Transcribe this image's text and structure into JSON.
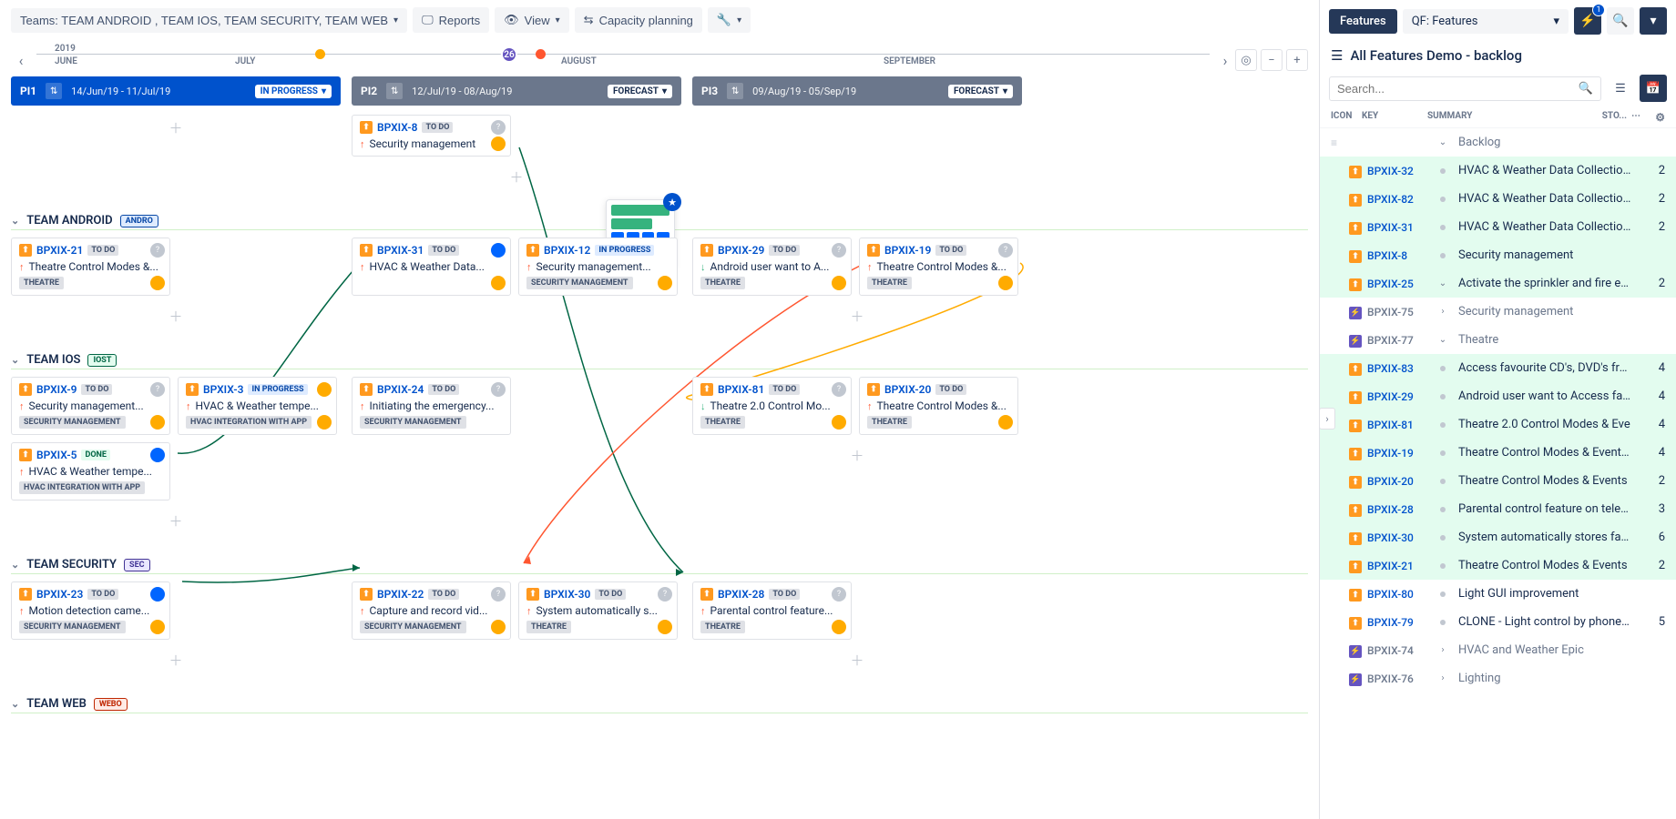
{
  "toolbar": {
    "teams_label": "Teams: TEAM ANDROID , TEAM IOS, TEAM SECURITY, TEAM WEB",
    "reports": "Reports",
    "view": "View",
    "capacity": "Capacity planning"
  },
  "timeline": {
    "year": "2019",
    "months": {
      "june": "JUNE",
      "july": "JULY",
      "august": "AUGUST",
      "september": "SEPTEMBER"
    },
    "badge": "26"
  },
  "pi": [
    {
      "name": "PI1",
      "dates": "14/Jun/19 - 11/Jul/19",
      "status": "IN PROGRESS"
    },
    {
      "name": "PI2",
      "dates": "12/Jul/19 - 08/Aug/19",
      "status": "FORECAST"
    },
    {
      "name": "PI3",
      "dates": "09/Aug/19 - 05/Sep/19",
      "status": "FORECAST"
    }
  ],
  "teams": {
    "android": {
      "name": "TEAM ANDROID",
      "badge": "ANDRO"
    },
    "ios": {
      "name": "TEAM IOS",
      "badge": "IOST"
    },
    "security": {
      "name": "TEAM SECURITY",
      "badge": "SEC"
    },
    "web": {
      "name": "TEAM WEB",
      "badge": "WEBO"
    }
  },
  "cards": {
    "bpxix8": {
      "key": "BPXIX-8",
      "status": "TO DO",
      "summary": "Security management"
    },
    "bpxix21": {
      "key": "BPXIX-21",
      "status": "TO DO",
      "summary": "Theatre Control Modes &...",
      "tag": "THEATRE"
    },
    "bpxix31": {
      "key": "BPXIX-31",
      "status": "TO DO",
      "summary": "HVAC & Weather Data..."
    },
    "bpxix12": {
      "key": "BPXIX-12",
      "status": "IN PROGRESS",
      "summary": "Security management...",
      "tag": "SECURITY MANAGEMENT"
    },
    "bpxix29": {
      "key": "BPXIX-29",
      "status": "TO DO",
      "summary": "Android user want to A...",
      "tag": "THEATRE"
    },
    "bpxix19": {
      "key": "BPXIX-19",
      "status": "TO DO",
      "summary": "Theatre Control Modes &...",
      "tag": "THEATRE"
    },
    "bpxix9": {
      "key": "BPXIX-9",
      "status": "TO DO",
      "summary": "Security management...",
      "tag": "SECURITY MANAGEMENT"
    },
    "bpxix3": {
      "key": "BPXIX-3",
      "status": "IN PROGRESS",
      "summary": "HVAC & Weather tempe...",
      "tag": "HVAC INTEGRATION WITH APP"
    },
    "bpxix24": {
      "key": "BPXIX-24",
      "status": "TO DO",
      "summary": "Initiating the emergency...",
      "tag": "SECURITY MANAGEMENT"
    },
    "bpxix81": {
      "key": "BPXIX-81",
      "status": "TO DO",
      "summary": "Theatre 2.0 Control Mo...",
      "tag": "THEATRE"
    },
    "bpxix20": {
      "key": "BPXIX-20",
      "status": "TO DO",
      "summary": "Theatre Control Modes &...",
      "tag": "THEATRE"
    },
    "bpxix5": {
      "key": "BPXIX-5",
      "status": "DONE",
      "summary": "HVAC & Weather tempe...",
      "tag": "HVAC INTEGRATION WITH APP"
    },
    "bpxix23": {
      "key": "BPXIX-23",
      "status": "TO DO",
      "summary": "Motion detection came...",
      "tag": "SECURITY MANAGEMENT"
    },
    "bpxix22": {
      "key": "BPXIX-22",
      "status": "TO DO",
      "summary": "Capture and record vid...",
      "tag": "SECURITY MANAGEMENT"
    },
    "bpxix30": {
      "key": "BPXIX-30",
      "status": "TO DO",
      "summary": "System automatically s...",
      "tag": "THEATRE"
    },
    "bpxix28": {
      "key": "BPXIX-28",
      "status": "TO DO",
      "summary": "Parental control feature...",
      "tag": "THEATRE"
    }
  },
  "side": {
    "features_tab": "Features",
    "qf": "QF: Features",
    "title": "All Features Demo - backlog",
    "search_placeholder": "Search...",
    "cols": {
      "icon": "ICON",
      "key": "KEY",
      "summary": "SUMMARY",
      "sto": "STO..."
    },
    "backlog_label": "Backlog",
    "badge1": "1"
  },
  "backlog": [
    {
      "key": "BPXIX-32",
      "summary": "HVAC & Weather Data Collection for",
      "pts": "2",
      "hl": true,
      "type": "feat"
    },
    {
      "key": "BPXIX-82",
      "summary": "HVAC & Weather Data Collection for",
      "pts": "2",
      "hl": true,
      "type": "feat"
    },
    {
      "key": "BPXIX-31",
      "summary": "HVAC & Weather Data Collection for",
      "pts": "2",
      "hl": true,
      "type": "feat"
    },
    {
      "key": "BPXIX-8",
      "summary": "Security management",
      "pts": "",
      "hl": true,
      "type": "feat"
    },
    {
      "key": "BPXIX-25",
      "summary": "Activate the sprinkler and fire exting",
      "pts": "2",
      "hl": true,
      "type": "feat",
      "chev": "down"
    },
    {
      "key": "BPXIX-75",
      "summary": "Security management",
      "pts": "",
      "hl": false,
      "type": "epic",
      "gray": true,
      "chev": "right"
    },
    {
      "key": "BPXIX-77",
      "summary": "Theatre",
      "pts": "",
      "hl": false,
      "type": "epic",
      "gray": true,
      "chev": "down"
    },
    {
      "key": "BPXIX-83",
      "summary": "Access favourite CD's, DVD's from",
      "pts": "4",
      "hl": true,
      "type": "feat"
    },
    {
      "key": "BPXIX-29",
      "summary": "Android user want to Access favo",
      "pts": "4",
      "hl": true,
      "type": "feat"
    },
    {
      "key": "BPXIX-81",
      "summary": "Theatre 2.0 Control Modes & Eve",
      "pts": "4",
      "hl": true,
      "type": "feat"
    },
    {
      "key": "BPXIX-19",
      "summary": "Theatre Control Modes & Events .",
      "pts": "4",
      "hl": true,
      "type": "feat"
    },
    {
      "key": "BPXIX-20",
      "summary": "Theatre Control Modes & Events",
      "pts": "2",
      "hl": true,
      "type": "feat"
    },
    {
      "key": "BPXIX-28",
      "summary": "Parental control feature on televisi",
      "pts": "3",
      "hl": true,
      "type": "feat"
    },
    {
      "key": "BPXIX-30",
      "summary": "System automatically stores favo",
      "pts": "6",
      "hl": true,
      "type": "feat"
    },
    {
      "key": "BPXIX-21",
      "summary": "Theatre Control Modes & Events",
      "pts": "2",
      "hl": true,
      "type": "feat"
    },
    {
      "key": "BPXIX-80",
      "summary": "Light GUI improvement",
      "pts": "",
      "hl": false,
      "type": "feat"
    },
    {
      "key": "BPXIX-79",
      "summary": "CLONE - Light control by phone or ap",
      "pts": "5",
      "hl": false,
      "type": "feat"
    },
    {
      "key": "BPXIX-74",
      "summary": "HVAC and Weather Epic",
      "pts": "",
      "hl": false,
      "type": "epic",
      "gray": true,
      "chev": "right"
    },
    {
      "key": "BPXIX-76",
      "summary": "Lighting",
      "pts": "",
      "hl": false,
      "type": "epic",
      "gray": true,
      "chev": "right"
    }
  ]
}
